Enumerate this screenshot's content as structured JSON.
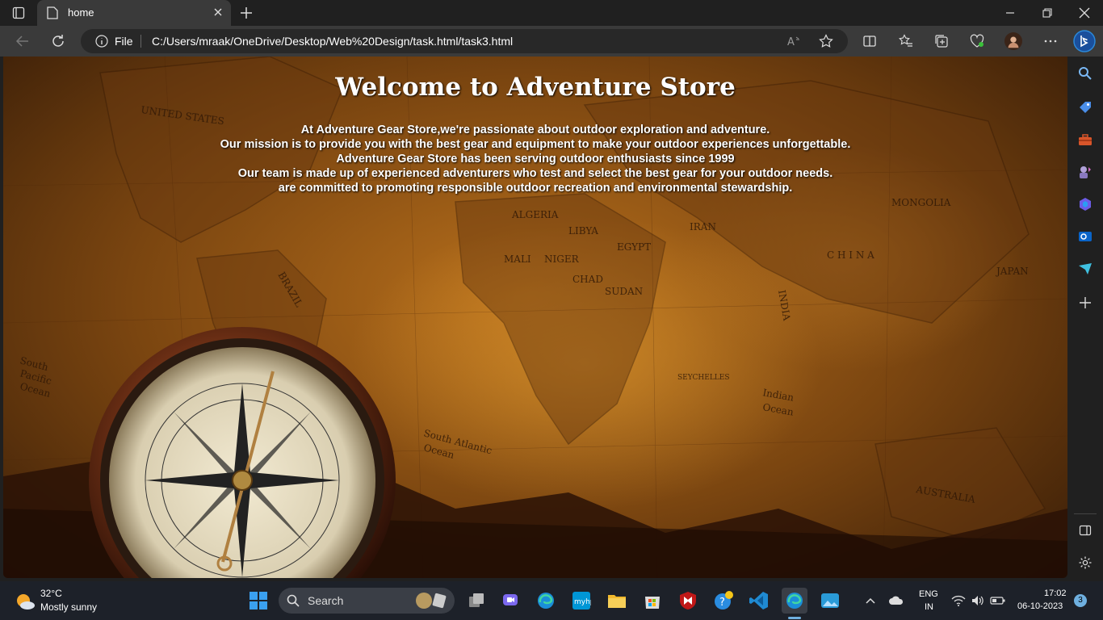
{
  "browser": {
    "tab_title": "home",
    "address_scheme": "File",
    "address_url": "C:/Users/mraak/OneDrive/Desktop/Web%20Design/task.html/task3.html"
  },
  "page": {
    "heading": "Welcome to Adventure Store",
    "lines": [
      "At Adventure Gear Store,we're passionate about outdoor exploration and adventure.",
      "Our mission is to provide you with the best gear and equipment to make your outdoor experiences unforgettable.",
      "Adventure Gear Store has been serving outdoor enthusiasts since 1999",
      "Our team is made up of experienced adventurers who test and select the best gear for your outdoor needs.",
      "are committed to promoting responsible outdoor recreation and environmental stewardship."
    ],
    "map_labels": [
      "UNITED STATES",
      "ALGERIA",
      "LIBYA",
      "EGYPT",
      "CHAD",
      "SUDAN",
      "NIGER",
      "MALI",
      "IRAN",
      "INDIA",
      "CHINA",
      "MONGOLIA",
      "AUSTRALIA",
      "Indian Ocean",
      "South Atlantic Ocean",
      "BRAZIL",
      "JAPAN",
      "SEYCHELLES",
      "South Pacific Ocean"
    ]
  },
  "taskbar": {
    "weather_temp": "32°C",
    "weather_desc": "Mostly sunny",
    "search_label": "Search",
    "lang_line1": "ENG",
    "lang_line2": "IN",
    "time": "17:02",
    "date": "06-10-2023",
    "notification_count": "3"
  },
  "colors": {
    "accent": "#0078d4",
    "parchment": "#b8701c"
  }
}
